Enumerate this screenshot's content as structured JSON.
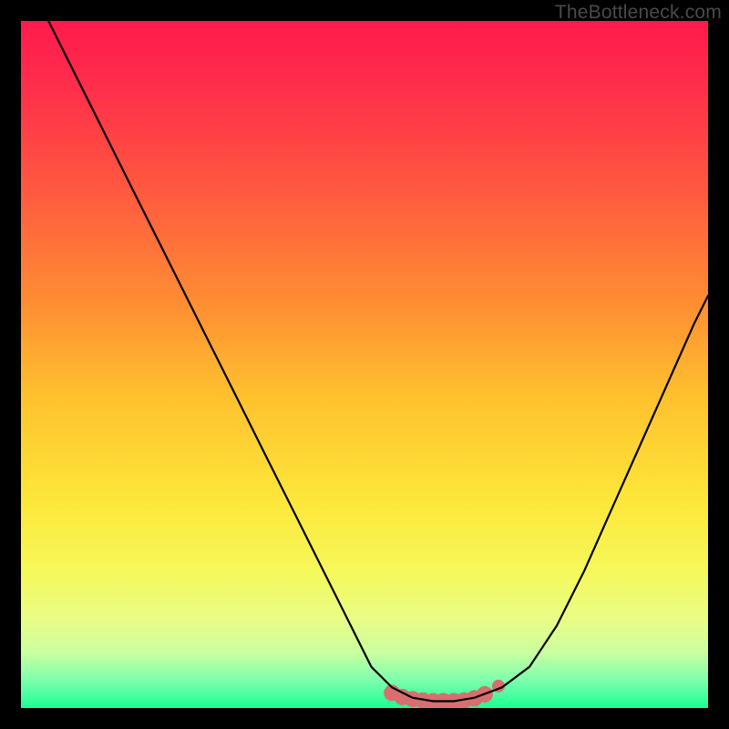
{
  "watermark": "TheBottleneck.com",
  "colors": {
    "frame": "#000000",
    "gradient_stops": [
      {
        "offset": 0.0,
        "color": "#ff1a4d"
      },
      {
        "offset": 0.1,
        "color": "#ff2f4a"
      },
      {
        "offset": 0.25,
        "color": "#ff5a3f"
      },
      {
        "offset": 0.4,
        "color": "#ff8a33"
      },
      {
        "offset": 0.55,
        "color": "#ffc22e"
      },
      {
        "offset": 0.7,
        "color": "#fde73a"
      },
      {
        "offset": 0.8,
        "color": "#f6f85a"
      },
      {
        "offset": 0.87,
        "color": "#e9fd86"
      },
      {
        "offset": 0.92,
        "color": "#c9ffa0"
      },
      {
        "offset": 0.96,
        "color": "#7bffad"
      },
      {
        "offset": 1.0,
        "color": "#1aff94"
      }
    ],
    "curve": "#000000",
    "marker": "#d76f6f"
  },
  "chart_data": {
    "type": "line",
    "title": "",
    "xlabel": "",
    "ylabel": "",
    "xlim": [
      0,
      100
    ],
    "ylim": [
      0,
      100
    ],
    "series": [
      {
        "name": "bottleneck-curve",
        "x": [
          0,
          4,
          8,
          12,
          16,
          20,
          24,
          28,
          32,
          36,
          40,
          44,
          48,
          51,
          54,
          57,
          60,
          63,
          66,
          70,
          74,
          78,
          82,
          86,
          90,
          94,
          98,
          100
        ],
        "y": [
          104,
          100,
          92,
          84,
          76,
          68,
          60,
          52,
          44,
          36,
          28,
          20,
          12,
          6,
          3,
          1.5,
          1.0,
          1.0,
          1.5,
          3,
          6,
          12,
          20,
          29,
          38,
          47,
          56,
          60
        ]
      }
    ],
    "markers": {
      "name": "highlight-band",
      "x": [
        54.0,
        55.5,
        57.0,
        58.5,
        60.0,
        61.5,
        63.0,
        64.5,
        66.0,
        67.5,
        69.5
      ],
      "y": [
        2.2,
        1.6,
        1.3,
        1.1,
        1.0,
        1.0,
        1.0,
        1.1,
        1.4,
        2.0,
        3.2
      ],
      "r": [
        9,
        9,
        9,
        9,
        9,
        9,
        9,
        9,
        9,
        9,
        7
      ]
    }
  }
}
